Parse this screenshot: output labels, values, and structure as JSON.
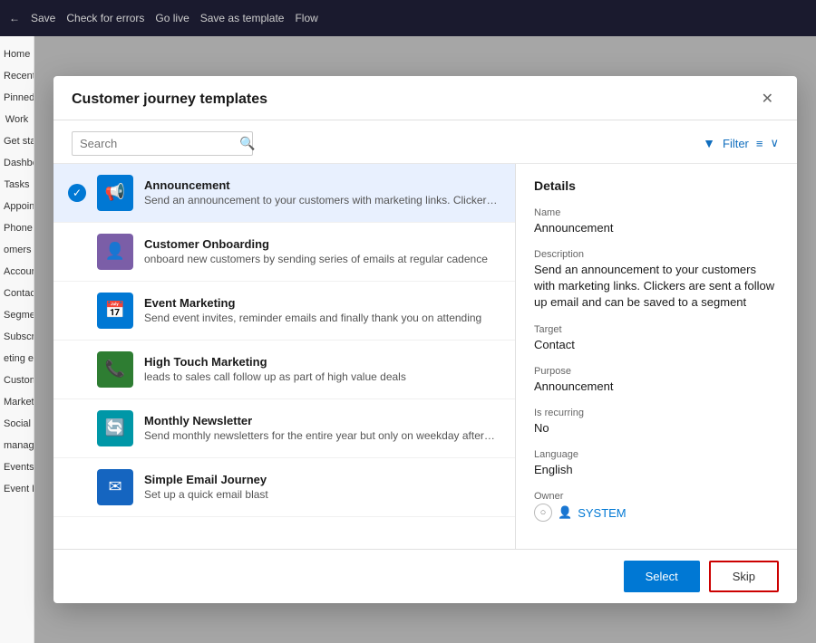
{
  "app": {
    "topbar": {
      "back_label": "←",
      "save_label": "Save",
      "check_errors_label": "Check for errors",
      "go_live_label": "Go live",
      "save_as_template_label": "Save as template",
      "flow_label": "Flow"
    },
    "sidebar": {
      "items": [
        {
          "label": "Home"
        },
        {
          "label": "Recent"
        },
        {
          "label": "Pinned"
        },
        {
          "label": "Work"
        },
        {
          "label": "Get start"
        },
        {
          "label": "Dashbo"
        },
        {
          "label": "Tasks"
        },
        {
          "label": "Appoint"
        },
        {
          "label": "Phone C"
        },
        {
          "label": "omers"
        },
        {
          "label": "Account"
        },
        {
          "label": "Contact"
        },
        {
          "label": "Segmen"
        },
        {
          "label": "Subscri"
        },
        {
          "label": "eting ex"
        },
        {
          "label": "Custome"
        },
        {
          "label": "Marketi"
        },
        {
          "label": "Social p"
        },
        {
          "label": "manag"
        },
        {
          "label": "Events"
        },
        {
          "label": "Event R"
        }
      ]
    }
  },
  "modal": {
    "title": "Customer journey templates",
    "close_label": "✕",
    "search": {
      "placeholder": "Search",
      "value": ""
    },
    "filter_label": "Filter",
    "templates": [
      {
        "id": "announcement",
        "name": "Announcement",
        "description": "Send an announcement to your customers with marketing links. Clickers are sent a...",
        "icon": "📢",
        "icon_class": "icon-blue",
        "selected": true
      },
      {
        "id": "customer-onboarding",
        "name": "Customer Onboarding",
        "description": "onboard new customers by sending series of emails at regular cadence",
        "icon": "👤",
        "icon_class": "icon-purple",
        "selected": false
      },
      {
        "id": "event-marketing",
        "name": "Event Marketing",
        "description": "Send event invites, reminder emails and finally thank you on attending",
        "icon": "📅",
        "icon_class": "icon-blue",
        "selected": false
      },
      {
        "id": "high-touch-marketing",
        "name": "High Touch Marketing",
        "description": "leads to sales call follow up as part of high value deals",
        "icon": "📞",
        "icon_class": "icon-green",
        "selected": false
      },
      {
        "id": "monthly-newsletter",
        "name": "Monthly Newsletter",
        "description": "Send monthly newsletters for the entire year but only on weekday afternoons",
        "icon": "🔄",
        "icon_class": "icon-cyan",
        "selected": false
      },
      {
        "id": "simple-email-journey",
        "name": "Simple Email Journey",
        "description": "Set up a quick email blast",
        "icon": "✉",
        "icon_class": "icon-dark-blue",
        "selected": false
      }
    ],
    "details": {
      "section_title": "Details",
      "fields": [
        {
          "label": "Name",
          "value": "Announcement"
        },
        {
          "label": "Description",
          "value": "Send an announcement to your customers with marketing links. Clickers are sent a follow up email and can be saved to a segment"
        },
        {
          "label": "Target",
          "value": "Contact"
        },
        {
          "label": "Purpose",
          "value": "Announcement"
        },
        {
          "label": "Is recurring",
          "value": "No"
        },
        {
          "label": "Language",
          "value": "English"
        }
      ],
      "owner_label": "Owner",
      "owner_name": "SYSTEM"
    },
    "footer": {
      "select_label": "Select",
      "skip_label": "Skip"
    }
  }
}
